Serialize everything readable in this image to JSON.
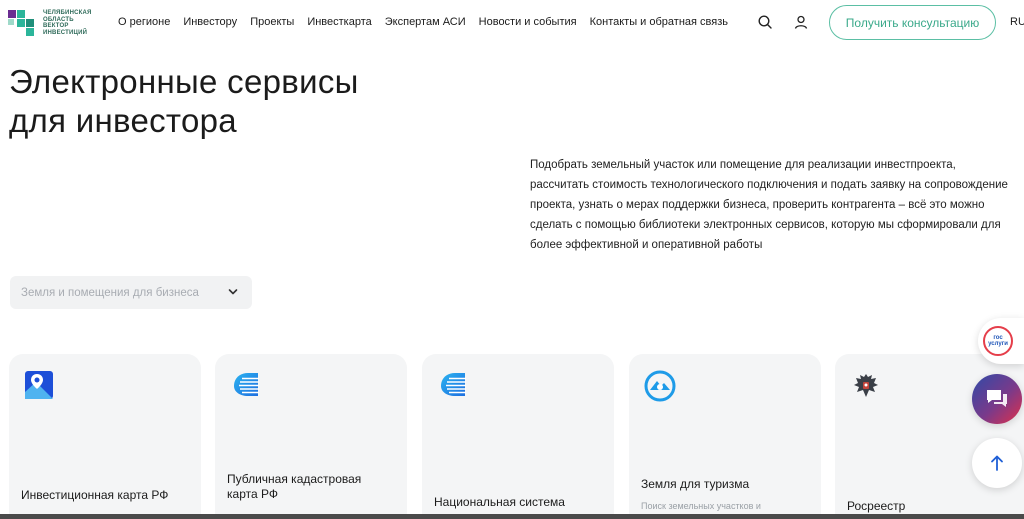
{
  "header": {
    "logo_lines": [
      "ЧЕЛЯБИНСКАЯ",
      "ОБЛАСТЬ",
      "ВЕКТОР",
      "ИНВЕСТИЦИЙ"
    ],
    "nav": [
      {
        "label": "О регионе"
      },
      {
        "label": "Инвестору"
      },
      {
        "label": "Проекты"
      },
      {
        "label": "Инвесткарта"
      },
      {
        "label": "Экспертам АСИ"
      },
      {
        "label": "Новости и события"
      },
      {
        "label": "Контакты и обратная связь"
      }
    ],
    "cta_label": "Получить консультацию",
    "lang": "RU",
    "icons": [
      "search-icon",
      "user-icon"
    ]
  },
  "page": {
    "title_line1": "Электронные сервисы",
    "title_line2": "для инвестора",
    "description": "Подобрать земельный участок или помещение для реализации инвестпроекта, рассчитать стоимость технологического подключения и подать заявку на сопровождение проекта, узнать о мерах поддержки бизнеса, проверить контрагента – всё это можно сделать с помощью библиотеки электронных сервисов, которую мы сформировали для более эффективной и оперативной работы"
  },
  "filter": {
    "placeholder": "Земля и помещения для бизнеса"
  },
  "cards": [
    {
      "title": "Инвестиционная карта РФ",
      "subtitle": "",
      "icon": "map-pin-icon"
    },
    {
      "title": "Публичная кадастровая карта РФ",
      "subtitle": "",
      "icon": "layers-icon"
    },
    {
      "title": "Национальная система",
      "subtitle": "",
      "icon": "layers-icon"
    },
    {
      "title": "Земля для туризма",
      "subtitle": "Поиск земельных участков и",
      "icon": "tourism-icon"
    },
    {
      "title": "Росреестр",
      "subtitle": "",
      "icon": "emblem-icon"
    }
  ],
  "floating": {
    "gosuslugi_text": "гос услуги",
    "icons": [
      "gosuslugi-icon",
      "chat-icon",
      "arrow-up-icon"
    ]
  },
  "colors": {
    "accent": "#3aa98a",
    "card_bg": "#f4f5f6",
    "select_bg": "#f1f2f3",
    "chat_gradient_start": "#2f4aa8",
    "chat_gradient_end": "#e0304a"
  }
}
